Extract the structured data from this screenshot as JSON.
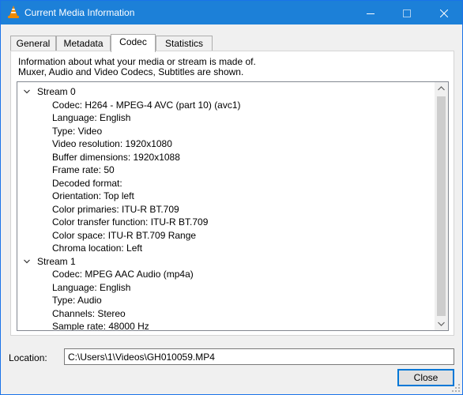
{
  "window": {
    "title": "Current Media Information",
    "title_bar_color": "#1c80d8",
    "icons": {
      "app": "vlc-cone-icon",
      "minimize": "minimize-icon",
      "maximize": "maximize-icon",
      "close": "close-icon"
    }
  },
  "tabs": [
    {
      "label": "General",
      "active": false
    },
    {
      "label": "Metadata",
      "active": false
    },
    {
      "label": "Codec",
      "active": true
    },
    {
      "label": "Statistics",
      "active": false
    }
  ],
  "codec": {
    "description_line1": "Information about what your media or stream is made of.",
    "description_line2": "Muxer, Audio and Video Codecs, Subtitles are shown.",
    "streams": [
      {
        "label": "Stream 0",
        "expanded": true,
        "properties": [
          "Codec: H264 - MPEG-4 AVC (part 10) (avc1)",
          "Language: English",
          "Type: Video",
          "Video resolution: 1920x1080",
          "Buffer dimensions: 1920x1088",
          "Frame rate: 50",
          "Decoded format:",
          "Orientation: Top left",
          "Color primaries: ITU-R BT.709",
          "Color transfer function: ITU-R BT.709",
          "Color space: ITU-R BT.709 Range",
          "Chroma location: Left"
        ]
      },
      {
        "label": "Stream 1",
        "expanded": true,
        "properties": [
          "Codec: MPEG AAC Audio (mp4a)",
          "Language: English",
          "Type: Audio",
          "Channels: Stereo",
          "Sample rate: 48000 Hz"
        ]
      }
    ]
  },
  "location": {
    "label": "Location:",
    "value": "C:\\Users\\1\\Videos\\GH010059.MP4"
  },
  "buttons": {
    "close": "Close"
  }
}
